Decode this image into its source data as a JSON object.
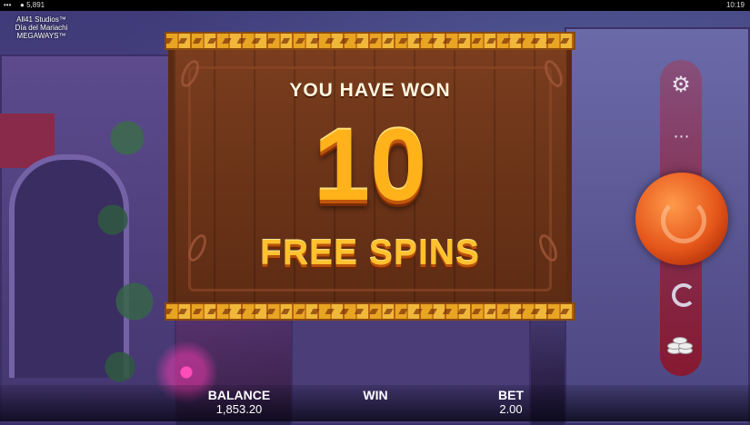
{
  "status_bar": {
    "dots": "•••",
    "players": "5,891",
    "clock": "10:19"
  },
  "game_title": {
    "line1": "All41 Studios™",
    "line2": "Día del Mariachi",
    "line3": "MEGAWAYS™"
  },
  "popup": {
    "heading": "YOU HAVE WON",
    "amount": "10",
    "subheading": "FREE SPINS"
  },
  "side_controls": {
    "settings_icon": "gear-icon",
    "menu_icon": "grid-dots-icon",
    "spin_icon": "spin-icon",
    "autoplay_icon": "autoplay-icon",
    "bet_icon": "coin-stack-icon"
  },
  "bottom_bar": {
    "balance_label": "BALANCE",
    "balance_value": "1,853.20",
    "win_label": "WIN",
    "bet_label": "BET",
    "bet_value": "2.00"
  },
  "colors": {
    "popup_wood": "#6b3418",
    "gold_text": "#ffb21a",
    "spin_button": "#e5561a",
    "side_panel": "#8c1428"
  }
}
